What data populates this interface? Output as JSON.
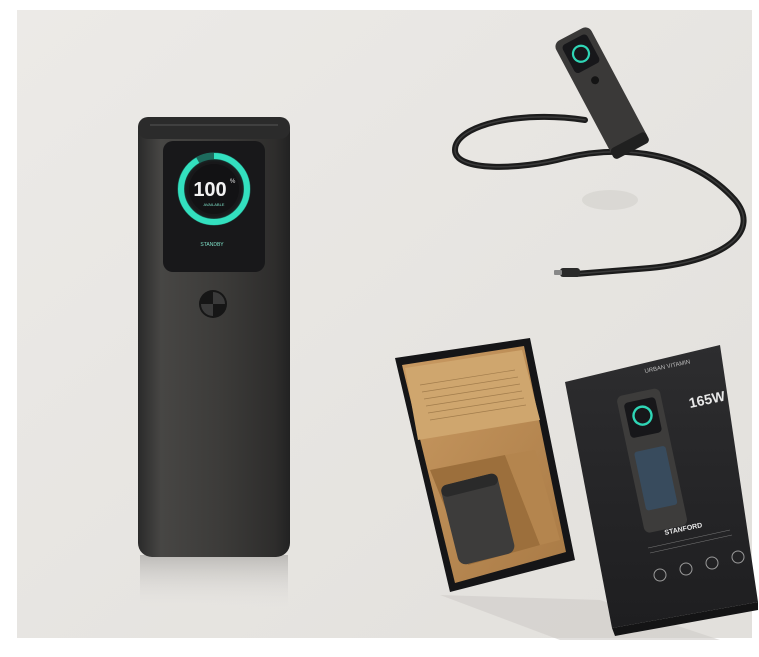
{
  "image": {
    "description_colors": {
      "background": "#e6e4e1",
      "device_body": "#3c3b3a",
      "screen": "#1a1a1c",
      "ring_outer": "#2fd6b6",
      "ring_inner": "#1f8f7a",
      "cardboard": "#b88b55",
      "box_dark": "#262628"
    }
  },
  "display": {
    "percent": "100",
    "sub_label": "AVAILABLE",
    "status_label": "STANDBY"
  },
  "box": {
    "brand": "URBAN VITAMIN",
    "wattage": "165W",
    "model": "STANFORD"
  }
}
